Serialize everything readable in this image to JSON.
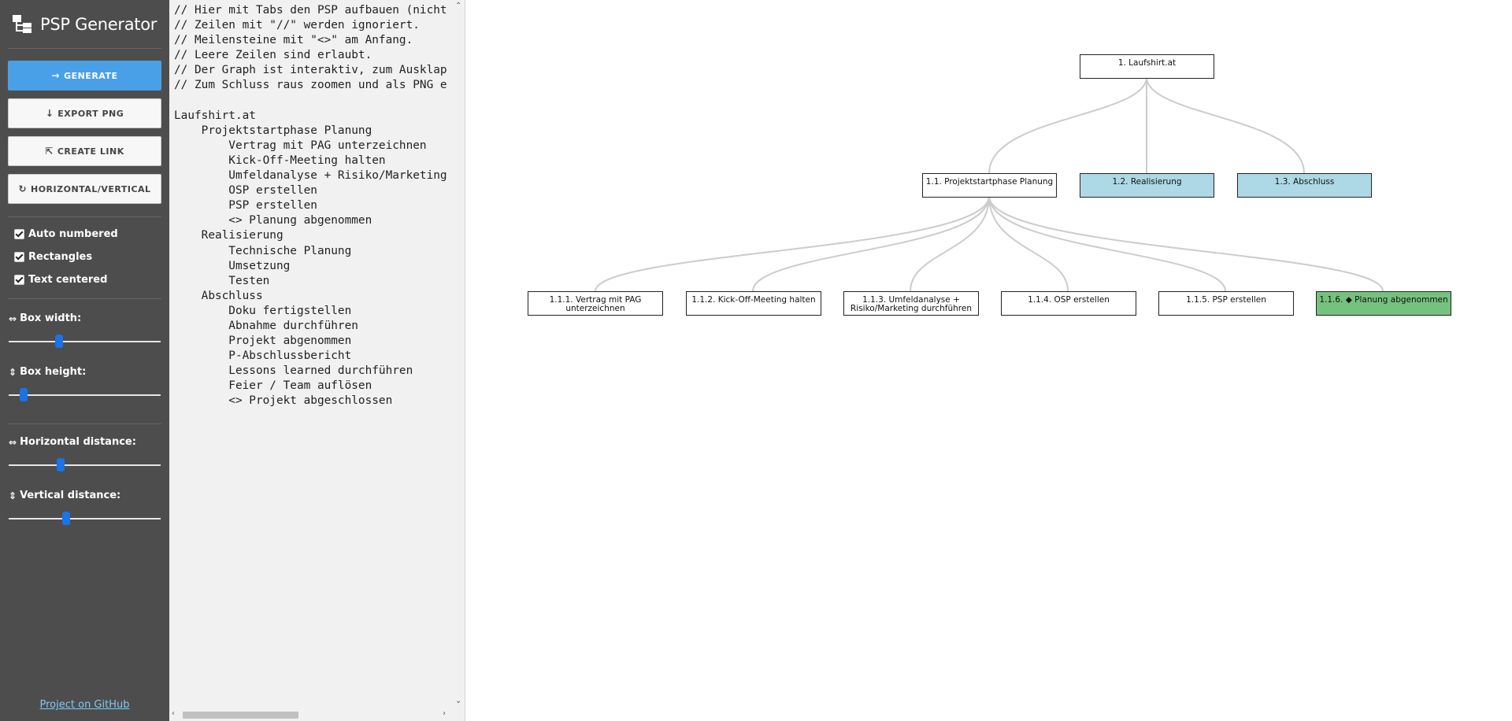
{
  "app": {
    "title": "PSP Generator"
  },
  "buttons": {
    "generate": "GENERATE",
    "export_png": "EXPORT PNG",
    "create_link": "CREATE LINK",
    "orientation": "HORIZONTAL/VERTICAL"
  },
  "options": {
    "auto_numbered": {
      "label": "Auto numbered",
      "checked": true
    },
    "rectangles": {
      "label": "Rectangles",
      "checked": true
    },
    "text_centered": {
      "label": "Text centered",
      "checked": true
    }
  },
  "sliders": {
    "box_width": {
      "label": "Box width:",
      "value": 0.33
    },
    "box_height": {
      "label": "Box height:",
      "value": 0.1
    },
    "horizontal_distance": {
      "label": "Horizontal distance:",
      "value": 0.34
    },
    "vertical_distance": {
      "label": "Vertical distance:",
      "value": 0.38
    }
  },
  "footer": {
    "github_link": "Project on GitHub"
  },
  "editor": {
    "lines": [
      "// Hier mit Tabs den PSP aufbauen (nicht",
      "// Zeilen mit \"//\" werden ignoriert.",
      "// Meilensteine mit \"<>\" am Anfang.",
      "// Leere Zeilen sind erlaubt.",
      "// Der Graph ist interaktiv, zum Ausklap",
      "// Zum Schluss raus zoomen und als PNG e",
      "",
      "Laufshirt.at",
      "    Projektstartphase Planung",
      "        Vertrag mit PAG unterzeichnen",
      "        Kick-Off-Meeting halten",
      "        Umfeldanalyse + Risiko/Marketing",
      "        OSP erstellen",
      "        PSP erstellen",
      "        <> Planung abgenommen",
      "    Realisierung",
      "        Technische Planung",
      "        Umsetzung",
      "        Testen",
      "    Abschluss",
      "        Doku fertigstellen",
      "        Abnahme durchführen",
      "        Projekt abgenommen",
      "        P-Abschlussbericht",
      "        Lessons learned durchführen",
      "        Feier / Team auflösen",
      "        <> Projekt abgeschlossen"
    ]
  },
  "tree": {
    "root": {
      "label": "1. Laufshirt.at"
    },
    "level1": [
      {
        "label": "1.1. Projektstartphase Planung",
        "state": "expanded",
        "color": "#ffffff"
      },
      {
        "label": "1.2. Realisierung",
        "state": "collapsed",
        "color": "#add8e6"
      },
      {
        "label": "1.3. Abschluss",
        "state": "collapsed",
        "color": "#add8e6"
      }
    ],
    "level2": [
      {
        "label": "1.1.1. Vertrag mit PAG unterzeichnen",
        "color": "#ffffff"
      },
      {
        "label": "1.1.2. Kick-Off-Meeting halten",
        "color": "#ffffff"
      },
      {
        "label": "1.1.3. Umfeldanalyse + Risiko/Marketing durchführen",
        "color": "#ffffff"
      },
      {
        "label": "1.1.4. OSP erstellen",
        "color": "#ffffff"
      },
      {
        "label": "1.1.5. PSP erstellen",
        "color": "#ffffff"
      },
      {
        "label": "1.1.6. ◆ Planung abgenommen",
        "color": "#75c27f",
        "milestone": true
      }
    ]
  },
  "colors": {
    "sidebar": "#4d4d4d",
    "primary": "#4aa0e6",
    "editor_bg": "#f1f1f1",
    "link": "#7ecaf5",
    "collapsed_node": "#add8e6",
    "milestone_node": "#75c27f"
  }
}
